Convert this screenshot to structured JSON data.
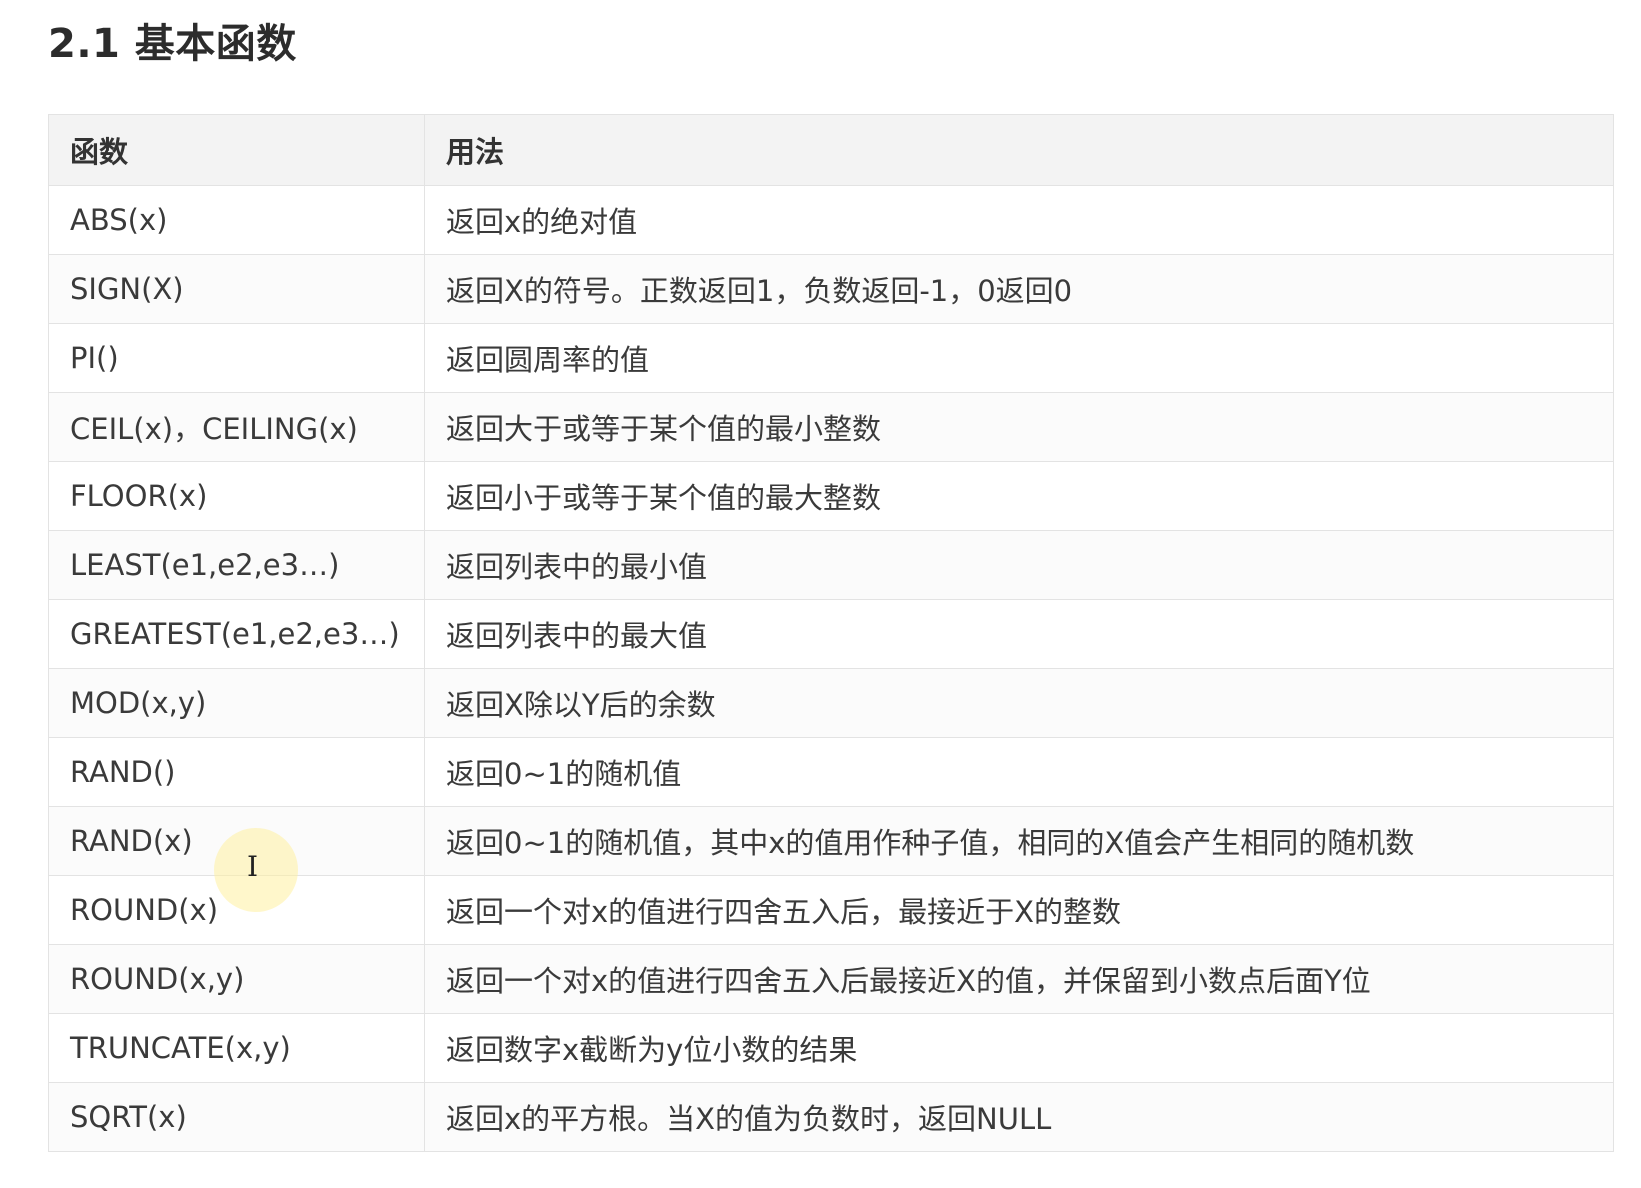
{
  "section": {
    "title": "2.1 基本函数"
  },
  "table": {
    "headers": {
      "function": "函数",
      "usage": "用法"
    },
    "rows": [
      {
        "function": "ABS(x)",
        "usage": "返回x的绝对值"
      },
      {
        "function": "SIGN(X)",
        "usage": "返回X的符号。正数返回1，负数返回-1，0返回0"
      },
      {
        "function": "PI()",
        "usage": "返回圆周率的值"
      },
      {
        "function": "CEIL(x)，CEILING(x)",
        "usage": "返回大于或等于某个值的最小整数"
      },
      {
        "function": "FLOOR(x)",
        "usage": "返回小于或等于某个值的最大整数"
      },
      {
        "function": "LEAST(e1,e2,e3…)",
        "usage": "返回列表中的最小值"
      },
      {
        "function": "GREATEST(e1,e2,e3…)",
        "usage": "返回列表中的最大值"
      },
      {
        "function": "MOD(x,y)",
        "usage": "返回X除以Y后的余数"
      },
      {
        "function": "RAND()",
        "usage": "返回0~1的随机值"
      },
      {
        "function": "RAND(x)",
        "usage": "返回0~1的随机值，其中x的值用作种子值，相同的X值会产生相同的随机数"
      },
      {
        "function": "ROUND(x)",
        "usage": "返回一个对x的值进行四舍五入后，最接近于X的整数"
      },
      {
        "function": "ROUND(x,y)",
        "usage": "返回一个对x的值进行四舍五入后最接近X的值，并保留到小数点后面Y位"
      },
      {
        "function": "TRUNCATE(x,y)",
        "usage": "返回数字x截断为y位小数的结果"
      },
      {
        "function": "SQRT(x)",
        "usage": "返回x的平方根。当X的值为负数时，返回NULL"
      }
    ]
  },
  "cursor": {
    "icon": "text-cursor-icon",
    "glyph": "I",
    "highlight_color": "#fff0a0"
  }
}
